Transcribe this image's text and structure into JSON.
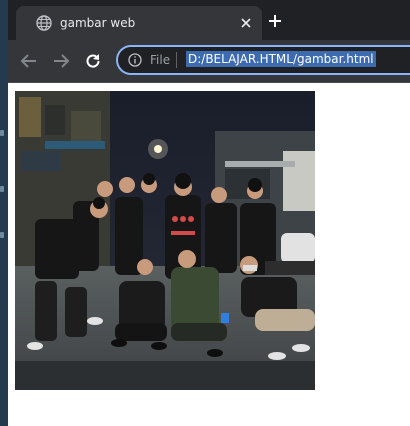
{
  "tab": {
    "title": "gambar web",
    "favicon": "globe-icon",
    "close_icon": "close-icon"
  },
  "toolbar": {
    "back_icon": "arrow-left-icon",
    "forward_icon": "arrow-right-icon",
    "reload_icon": "reload-icon",
    "new_tab_icon": "plus-icon"
  },
  "address_bar": {
    "info_icon": "info-icon",
    "scheme_label": "File",
    "url": "D:/BELAJAR.HTML/gambar.html"
  },
  "page": {
    "image_alt": "group photo"
  },
  "colors": {
    "tabstrip": "#202124",
    "toolbar": "#35363a",
    "omnibox_border": "#8ab4f8",
    "url_highlight": "#3c6bb0",
    "page_bg": "#ffffff"
  }
}
